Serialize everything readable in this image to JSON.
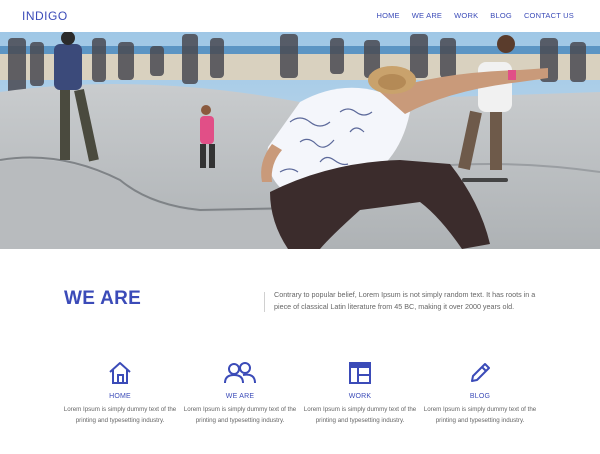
{
  "header": {
    "brand": "INDIGO",
    "nav": [
      "HOME",
      "WE ARE",
      "WORK",
      "BLOG",
      "CONTACT US"
    ]
  },
  "about": {
    "title": "WE ARE",
    "text": "Contrary to popular belief, Lorem Ipsum is not simply random text. It has roots in a piece of classical Latin literature from 45 BC, making it over 2000 years old."
  },
  "features": [
    {
      "icon": "home-icon",
      "title": "HOME",
      "text": "Lorem Ipsum is simply dummy text of the printing and typesetting industry."
    },
    {
      "icon": "users-icon",
      "title": "WE ARE",
      "text": "Lorem Ipsum is simply dummy text of the printing and typesetting industry."
    },
    {
      "icon": "layout-icon",
      "title": "WORK",
      "text": "Lorem Ipsum is simply dummy text of the printing and typesetting industry."
    },
    {
      "icon": "pencil-icon",
      "title": "BLOG",
      "text": "Lorem Ipsum is simply dummy text of the printing and typesetting industry."
    }
  ],
  "colors": {
    "accent": "#3b4bb8"
  }
}
